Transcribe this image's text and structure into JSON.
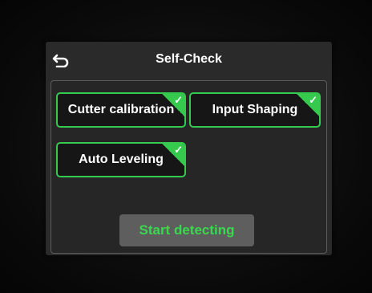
{
  "header": {
    "title": "Self-Check",
    "back_icon": "back-arrow-icon"
  },
  "tests": [
    {
      "label": "Cutter calibration",
      "checked": true,
      "check_icon": "checkmark-icon"
    },
    {
      "label": "Input Shaping",
      "checked": true,
      "check_icon": "checkmark-icon"
    },
    {
      "label": "Auto Leveling",
      "checked": true,
      "check_icon": "checkmark-icon"
    }
  ],
  "actions": {
    "start_label": "Start detecting"
  },
  "colors": {
    "accent": "#35c94d",
    "start_text": "#3ad84f",
    "screen_bg": "#2a2a2a",
    "tile_bg": "#161616"
  }
}
